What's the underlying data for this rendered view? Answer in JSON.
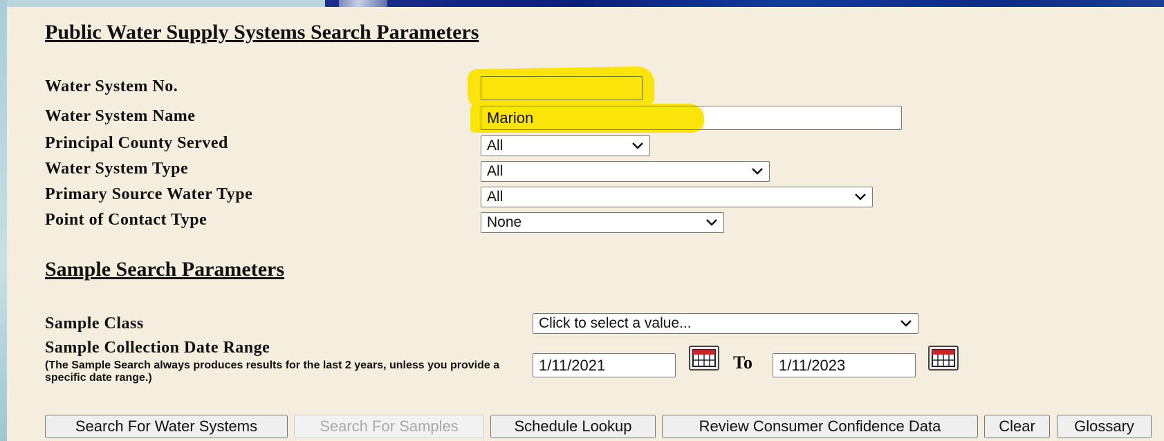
{
  "public_section": {
    "title": "Public Water Supply Systems Search Parameters",
    "fields": {
      "water_system_no": {
        "label": "Water System No.",
        "value": ""
      },
      "water_system_name": {
        "label": "Water System Name",
        "value": "Marion"
      },
      "principal_county": {
        "label": "Principal County Served",
        "selected": "All"
      },
      "system_type": {
        "label": "Water System Type",
        "selected": "All"
      },
      "source_type": {
        "label": "Primary Source Water Type",
        "selected": "All"
      },
      "contact_type": {
        "label": "Point of Contact Type",
        "selected": "None"
      }
    }
  },
  "sample_section": {
    "title": "Sample Search Parameters",
    "sample_class": {
      "label": "Sample Class",
      "selected": "Click to select a value..."
    },
    "date_range": {
      "label": "Sample Collection Date Range",
      "note": "(The Sample Search always produces results for the last 2 years, unless you provide a specific date range.)",
      "from": "1/11/2021",
      "to_label": "To",
      "to": "1/11/2023"
    }
  },
  "buttons": {
    "search_systems": "Search For Water Systems",
    "search_samples": "Search For Samples",
    "schedule_lookup": "Schedule Lookup",
    "review_ccr": "Review Consumer Confidence Data",
    "clear": "Clear",
    "glossary": "Glossary"
  },
  "colors": {
    "panel_bg": "#f5eddd",
    "highlight": "#fbe40a",
    "banner": "#0b1f7a"
  }
}
